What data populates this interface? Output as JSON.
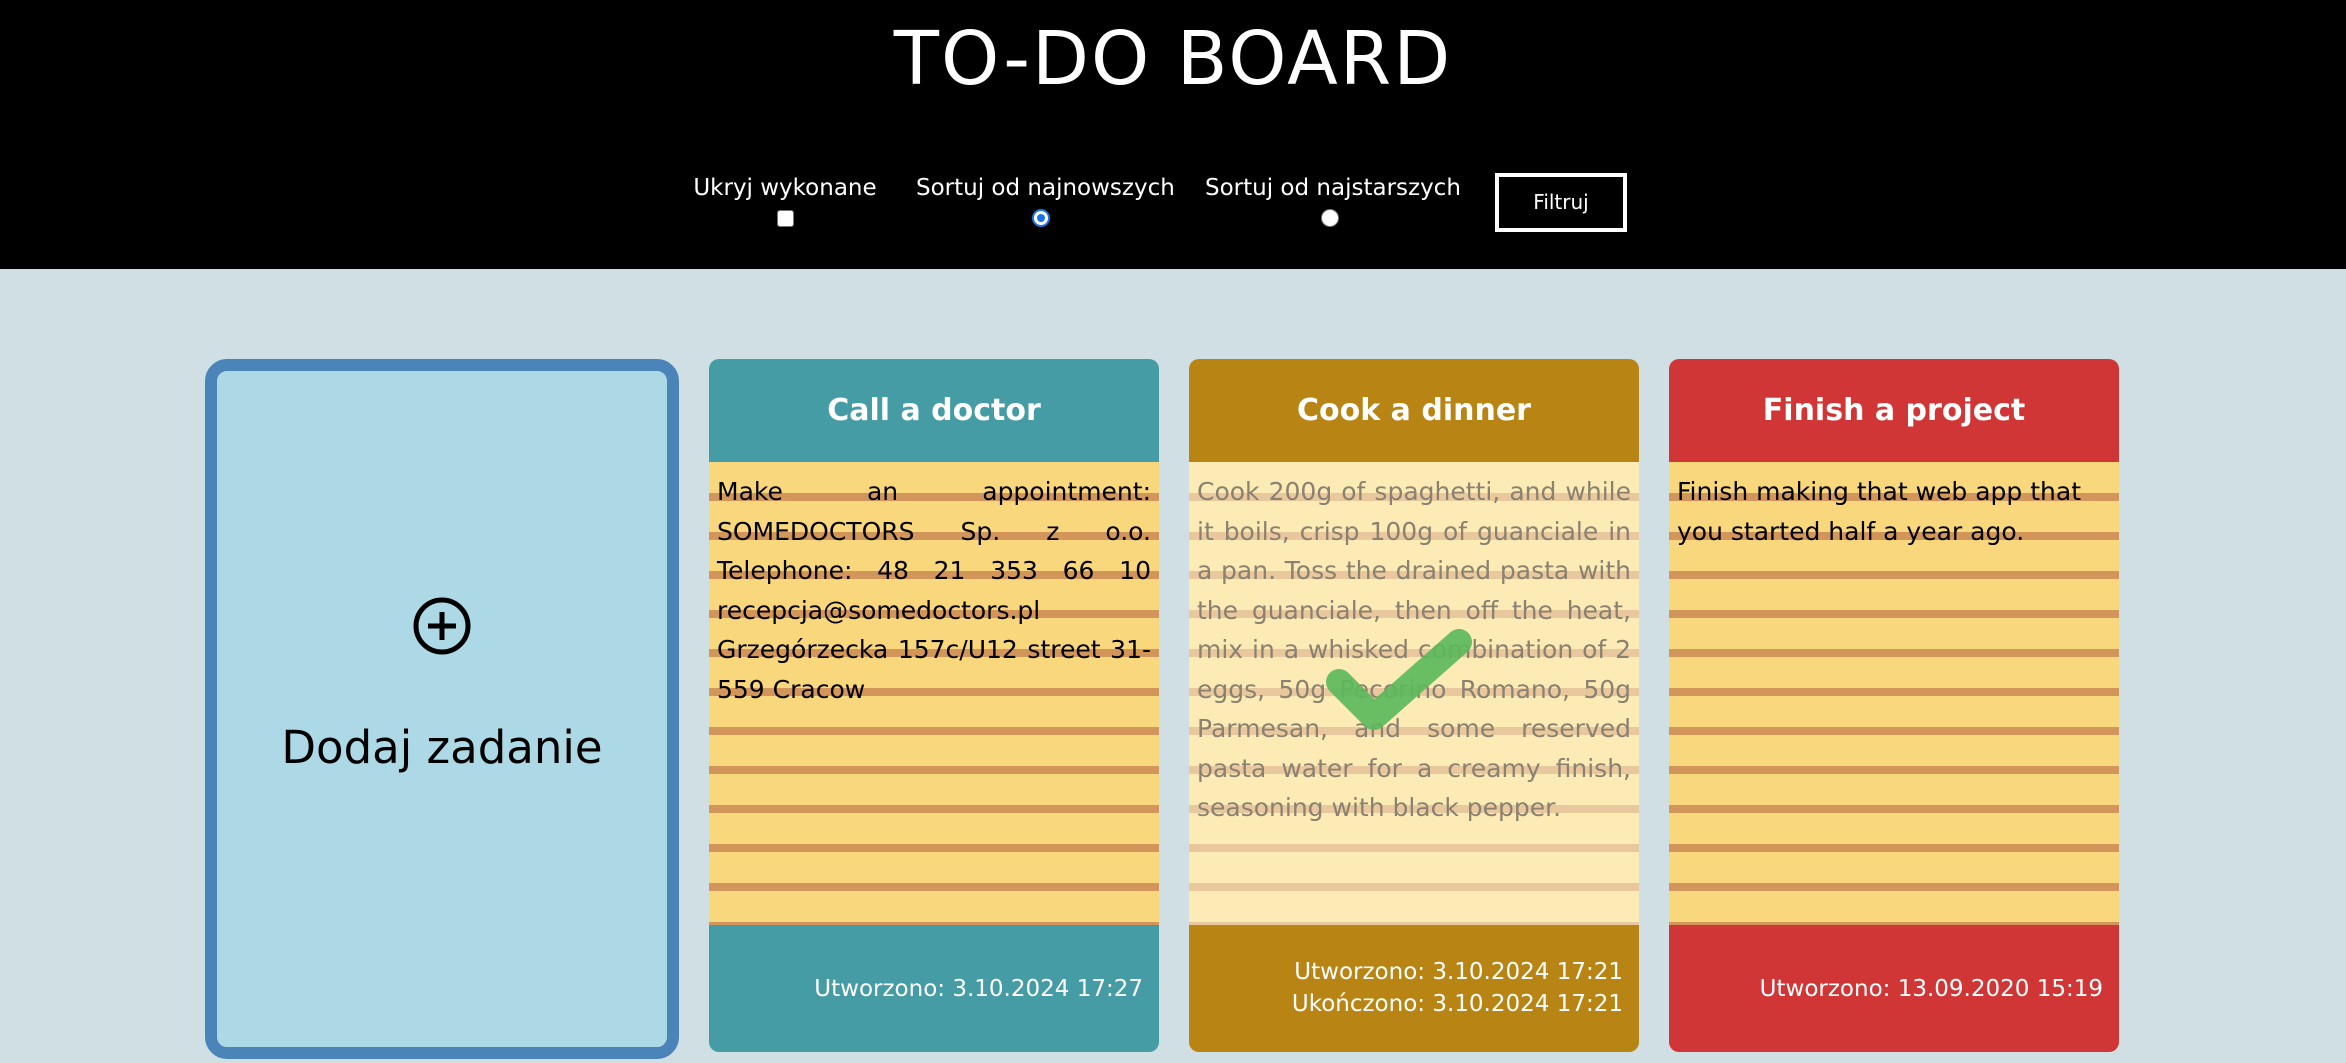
{
  "header": {
    "title": "TO-DO BOARD",
    "hide_done_label": "Ukryj wykonane",
    "sort_newest_label": "Sortuj od najnowszych",
    "sort_oldest_label": "Sortuj od najstarszych",
    "filter_button": "Filtruj",
    "hide_done_checked": false,
    "sort_selected": "newest"
  },
  "add_card": {
    "icon": "plus-circle-icon",
    "label": "Dodaj zadanie"
  },
  "tasks": [
    {
      "title": "Call a doctor",
      "description": "Make an appointment: SOMEDOCTORS Sp. z o.o. Telephone: 48 21 353 66 10 recepcja@somedoctors.pl Grzegórzecka 157c/U12 street 31-559 Cracow",
      "created": "Utworzono: 3.10.2024 17:27",
      "completed": "",
      "color": "#459ca4"
    },
    {
      "title": "Cook a dinner",
      "description": "Cook 200g of spaghetti, and while it boils, crisp 100g of guanciale in a pan. Toss the drained pasta with the guanciale, then off the heat, mix in a whisked combination of 2 eggs, 50g Pecorino Romano, 50g Parmesan, and some reserved pasta water for a creamy finish, seasoning with black pepper.",
      "created": "Utworzono: 3.10.2024 17:21",
      "completed": "Ukończono: 3.10.2024 17:21",
      "color": "#b88414",
      "done_icon": "checkmark-icon"
    },
    {
      "title": "Finish a project",
      "description": "Finish making that web app that you started half a year ago.",
      "created": "Utworzono: 13.09.2020 15:19",
      "completed": "",
      "color": "#d13637"
    }
  ]
}
